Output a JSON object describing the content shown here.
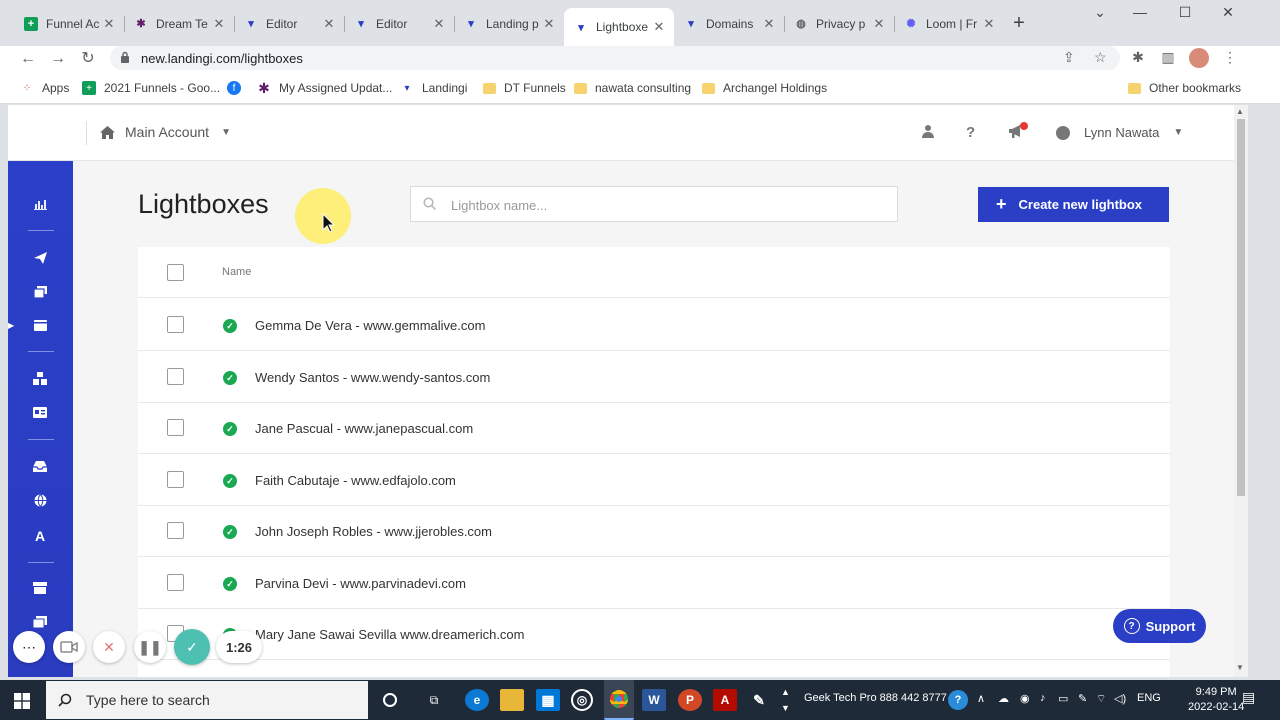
{
  "browser": {
    "tabs": [
      {
        "title": "Funnel Ac",
        "favicon": "sheets-icon",
        "color": "#0f9d58"
      },
      {
        "title": "Dream Te",
        "favicon": "slack-icon",
        "color": "#611f69"
      },
      {
        "title": "Editor",
        "favicon": "landingi-icon",
        "color": "#2a3ec6"
      },
      {
        "title": "Editor",
        "favicon": "landingi-icon",
        "color": "#2a3ec6"
      },
      {
        "title": "Landing p",
        "favicon": "landingi-icon",
        "color": "#2a3ec6"
      },
      {
        "title": "Lightboxe",
        "favicon": "landingi-icon",
        "color": "#2a3ec6",
        "active": true
      },
      {
        "title": "Domains",
        "favicon": "landingi-icon",
        "color": "#2a3ec6"
      },
      {
        "title": "Privacy p",
        "favicon": "globe-icon",
        "color": "#5f6368"
      },
      {
        "title": "Loom | Fr",
        "favicon": "loom-icon",
        "color": "#625df5"
      }
    ],
    "url": "new.landingi.com/lightboxes",
    "bookmarks": [
      {
        "label": "Apps",
        "icon": "apps-grid-icon"
      },
      {
        "label": "2021 Funnels - Goo...",
        "icon": "sheets-icon"
      },
      {
        "label": "",
        "icon": "facebook-icon"
      },
      {
        "label": "My Assigned Updat...",
        "icon": "slack-icon"
      },
      {
        "label": "Landingi",
        "icon": "landingi-icon"
      },
      {
        "label": "DT Funnels",
        "icon": "folder-icon"
      },
      {
        "label": "nawata consulting",
        "icon": "folder-icon"
      },
      {
        "label": "Archangel Holdings",
        "icon": "folder-icon"
      }
    ],
    "other_bookmarks": "Other bookmarks"
  },
  "app": {
    "account": "Main Account",
    "user": "Lynn Nawata",
    "title": "Lightboxes",
    "search_placeholder": "Lightbox name...",
    "create_label": "Create new lightbox",
    "column_name": "Name",
    "rows": [
      {
        "name": "Gemma De Vera - www.gemmalive.com"
      },
      {
        "name": "Wendy Santos - www.wendy-santos.com"
      },
      {
        "name": "Jane Pascual - www.janepascual.com"
      },
      {
        "name": "Faith Cabutaje - www.edfajolo.com"
      },
      {
        "name": "John Joseph Robles - www.jjerobles.com"
      },
      {
        "name": "Parvina Devi - www.parvinadevi.com"
      },
      {
        "name": "Mary Jane Sawai Sevilla www.dreamerich.com"
      }
    ],
    "support_label": "Support",
    "accent_color": "#2a3ec6",
    "status_color": "#1aa852"
  },
  "recorder": {
    "timer": "1:26"
  },
  "taskbar": {
    "search_placeholder": "Type here to search",
    "tray_text": "Geek Tech Pro 888 442 8777",
    "language": "ENG",
    "time": "9:49 PM",
    "date": "2022-02-14"
  }
}
